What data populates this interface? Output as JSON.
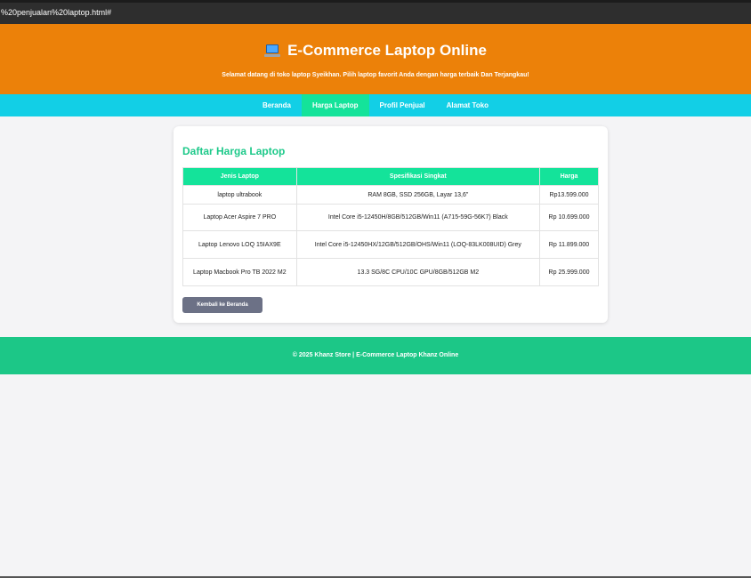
{
  "browser": {
    "url": "%20penjualan%20laptop.html#"
  },
  "header": {
    "icon": "laptop-icon",
    "title": "E-Commerce Laptop Online",
    "subtitle": "Selamat datang di toko laptop Syeikhan. Pilih laptop favorit Anda dengan harga terbaik Dan Terjangkau!",
    "color": "#ec8109"
  },
  "nav": {
    "color": "#12cfe6",
    "active_color": "#14e39a",
    "items": [
      {
        "label": "Beranda"
      },
      {
        "label": "Harga Laptop",
        "active": true
      },
      {
        "label": "Profil Penjual"
      },
      {
        "label": "Alamat Toko"
      }
    ]
  },
  "main": {
    "title": "Daftar Harga Laptop",
    "columns": [
      "Jenis Laptop",
      "Spesifikasi Singkat",
      "Harga"
    ],
    "rows": [
      {
        "name": "laptop ultrabook",
        "spec": "RAM 8GB, SSD 256GB, Layar 13,6\"",
        "price": "Rp13.599.000"
      },
      {
        "name": "Laptop Acer Aspire 7 PRO",
        "spec": "Intel Core i5-12450H/8GB/512GB/Win11 (A715-59G-56K7) Black",
        "price": "Rp 10.699.000"
      },
      {
        "name": "Laptop Lenovo LOQ 15IAX9E",
        "spec": "Intel Core i5-12450HX/12GB/512GB/OHS/Win11 (LOQ-83LK008UID) Grey",
        "price": "Rp 11.899.000"
      },
      {
        "name": "Laptop Macbook Pro TB 2022 M2",
        "spec": "13.3 SG/8C CPU/10C GPU/8GB/512GB M2",
        "price": "Rp 25.999.000"
      }
    ],
    "back_button": "Kembali ke Beranda"
  },
  "footer": {
    "text": "© 2025 Khanz Store | E-Commerce Laptop Khanz Online"
  }
}
